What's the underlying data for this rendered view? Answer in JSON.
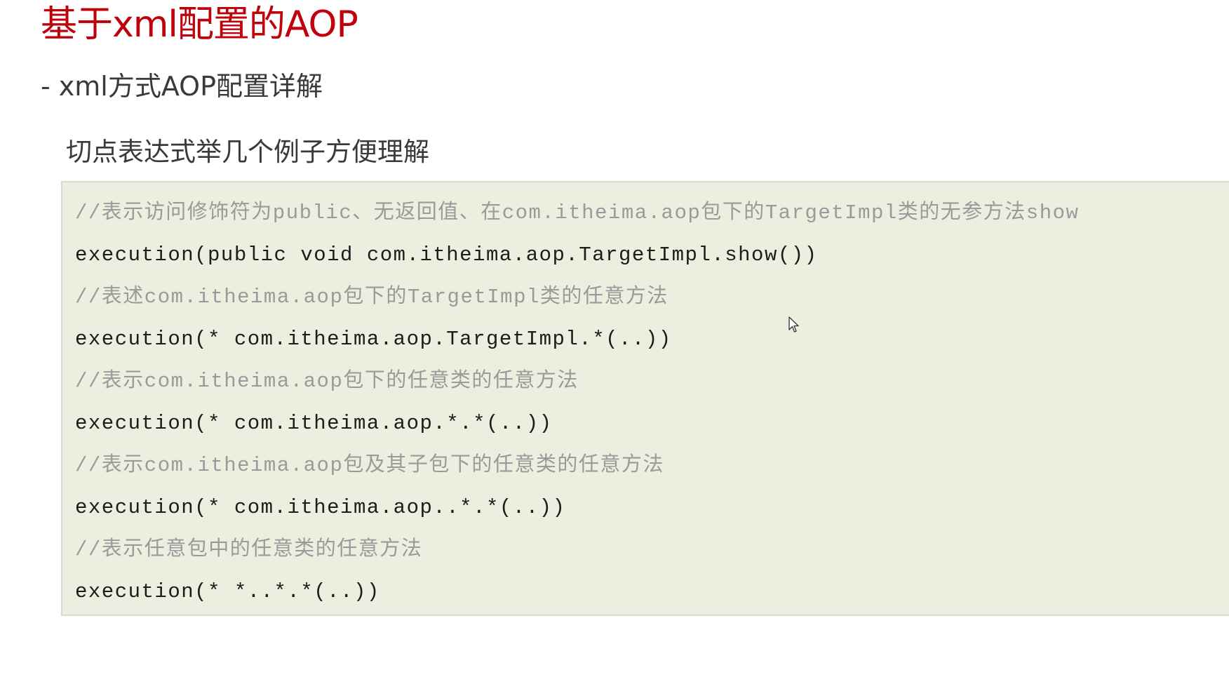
{
  "slide": {
    "title": "基于xml配置的AOP",
    "section_heading": "- xml方式AOP配置详解",
    "sub_heading": "切点表达式举几个例子方便理解"
  },
  "code_block": {
    "lines": [
      {
        "kind": "comment",
        "text": "//表示访问修饰符为public、无返回值、在com.itheima.aop包下的TargetImpl类的无参方法show"
      },
      {
        "kind": "code",
        "text": "execution(public void com.itheima.aop.TargetImpl.show())"
      },
      {
        "kind": "comment",
        "text": "//表述com.itheima.aop包下的TargetImpl类的任意方法"
      },
      {
        "kind": "code",
        "text": "execution(* com.itheima.aop.TargetImpl.*(..))"
      },
      {
        "kind": "comment",
        "text": "//表示com.itheima.aop包下的任意类的任意方法"
      },
      {
        "kind": "code",
        "text": "execution(* com.itheima.aop.*.*(..))"
      },
      {
        "kind": "comment",
        "text": "//表示com.itheima.aop包及其子包下的任意类的任意方法"
      },
      {
        "kind": "code",
        "text": "execution(* com.itheima.aop..*.*(..))"
      },
      {
        "kind": "comment",
        "text": "//表示任意包中的任意类的任意方法"
      },
      {
        "kind": "code",
        "text": "execution(* *..*.*(..))"
      }
    ]
  },
  "colors": {
    "title": "#c0000b",
    "heading": "#3a3a3a",
    "code_background": "#eaefdf",
    "comment_text": "#9a9a9a",
    "code_text": "#1c1c1c"
  },
  "icons": {
    "cursor": "mouse-pointer-icon"
  }
}
